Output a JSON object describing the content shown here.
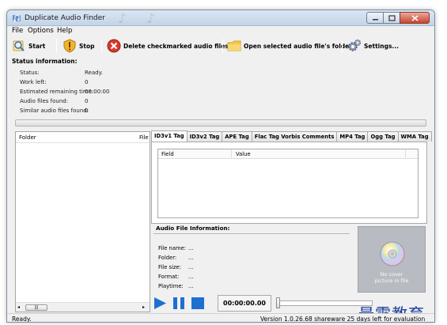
{
  "window": {
    "title": "Duplicate Audio Finder",
    "title_decoration": "♪ ♪"
  },
  "menu": [
    "File",
    "Options",
    "Help"
  ],
  "toolbar": {
    "start": "Start",
    "stop": "Stop",
    "delete": "Delete checkmarked audio files...",
    "open_folder": "Open selected audio file's folder",
    "settings": "Settings..."
  },
  "status_info": {
    "title": "Status information:",
    "rows": [
      {
        "label": "Status:",
        "value": "Ready."
      },
      {
        "label": "Work left:",
        "value": "0"
      },
      {
        "label": "Estimated remaining time:",
        "value": "00:00:00"
      },
      {
        "label": "Audio files found:",
        "value": "0"
      },
      {
        "label": "Similar audio files found:",
        "value": "0"
      }
    ]
  },
  "progress": {
    "fraction": 0
  },
  "left_panel": {
    "col_folder": "Folder",
    "col_file": "File"
  },
  "tabs": [
    "ID3v1 Tag",
    "ID3v2 Tag",
    "APE Tag",
    "Flac Tag Vorbis Comments",
    "MP4 Tag",
    "Ogg Tag",
    "WMA Tag"
  ],
  "active_tab": 0,
  "tag_grid": {
    "col_field": "Field",
    "col_value": "Value"
  },
  "file_info": {
    "title": "Audio File Information:",
    "rows": [
      {
        "label": "File name:",
        "value": "..."
      },
      {
        "label": "Folder:",
        "value": "..."
      },
      {
        "label": "File size:",
        "value": "..."
      },
      {
        "label": "Format:",
        "value": "..."
      },
      {
        "label": "Playtime:",
        "value": "..."
      }
    ]
  },
  "cover": {
    "line1": "No cover",
    "line2": "picture in file"
  },
  "player": {
    "time": "00:00:00.00",
    "position_fraction": 0
  },
  "watermark": "最需教育",
  "statusbar": {
    "left": "Ready.",
    "right": "Version 1.0.26.68 shareware 25 days left for evaluation"
  },
  "colors": {
    "accent_blue": "#1f6fd1",
    "stop_red": "#d63a2a",
    "folder_yellow": "#f2c94c"
  }
}
